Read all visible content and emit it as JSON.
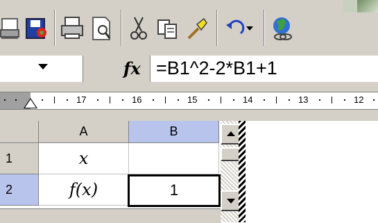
{
  "toolbar": {
    "buttons": [
      {
        "icon": "new-document-icon"
      },
      {
        "icon": "save-icon"
      },
      {
        "icon": "print-icon"
      },
      {
        "icon": "print-preview-icon"
      },
      {
        "icon": "cut-icon"
      },
      {
        "icon": "copy-icon"
      },
      {
        "icon": "format-painter-icon"
      },
      {
        "icon": "undo-icon"
      },
      {
        "icon": "hyperlink-icon"
      }
    ]
  },
  "formula_bar": {
    "fx_label": "fx",
    "formula": "=B1^2-2*B1+1"
  },
  "ruler": {
    "labels": [
      "17",
      "16",
      "15",
      "14",
      "13",
      "12"
    ]
  },
  "sheet": {
    "columns": [
      "A",
      "B"
    ],
    "rows": [
      "1",
      "2"
    ],
    "cells": {
      "A1": "x",
      "B1": "",
      "A2": "f(x)",
      "B2": "1"
    }
  },
  "colors": {
    "selected_header": "#b8c4ec",
    "toolbar_bg": "#d4d0c8"
  }
}
